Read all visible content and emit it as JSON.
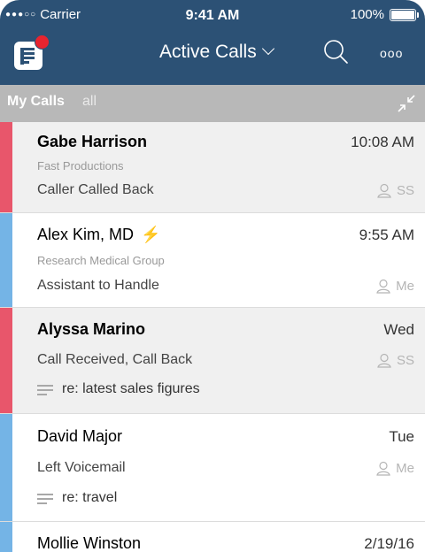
{
  "status_bar": {
    "carrier": "Carrier",
    "time": "9:41 AM",
    "battery": "100%"
  },
  "nav": {
    "title": "Active Calls",
    "more": "ooo"
  },
  "filter": {
    "my_calls": "My Calls",
    "all": "all"
  },
  "colors": {
    "header": "#2c5175",
    "red_stripe": "#e8566b",
    "blue_stripe": "#74b4e6",
    "bolt": "#f5a623"
  },
  "calls": [
    {
      "name": "Gabe Harrison",
      "time": "10:08 AM",
      "company": "Fast Productions",
      "status": "Caller Called Back",
      "assignee": "SS"
    },
    {
      "name": "Alex Kim, MD",
      "time": "9:55 AM",
      "company": "Research Medical Group",
      "status": "Assistant to Handle",
      "assignee": "Me"
    },
    {
      "name": "Alyssa Marino",
      "time": "Wed",
      "status": "Call Received, Call Back",
      "assignee": "SS",
      "note": "re: latest sales figures"
    },
    {
      "name": "David Major",
      "time": "Tue",
      "status": "Left Voicemail",
      "assignee": "Me",
      "note": "re: travel"
    },
    {
      "name": "Mollie Winston",
      "time": "2/19/16"
    }
  ]
}
